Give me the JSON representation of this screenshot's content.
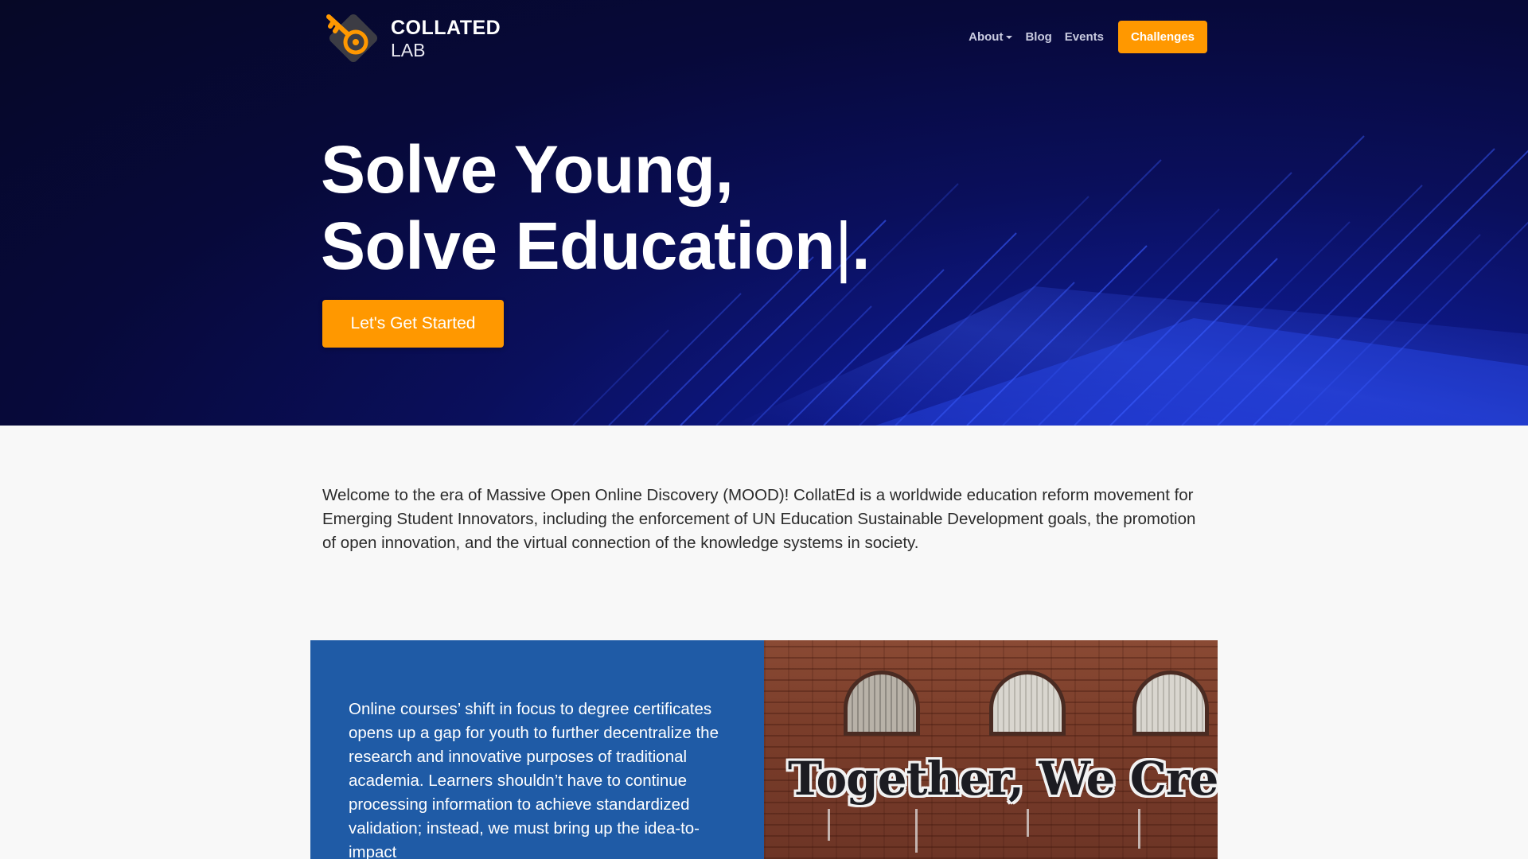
{
  "brand": {
    "name_line1": "COLLATED",
    "name_line2": "LAB",
    "accent_color": "#ff9800",
    "hero_bg_color": "#0a0f5c",
    "feature_bg_color": "#1f5ba6"
  },
  "nav": {
    "about": "About",
    "blog": "Blog",
    "events": "Events",
    "challenges": "Challenges"
  },
  "hero": {
    "line1": "Solve Young,",
    "line2": "Solve Education",
    "cursor": "|",
    "period": ".",
    "cta": "Let's Get Started"
  },
  "intro": {
    "text": "Welcome to the era of Massive Open Online Discovery (MOOD)! CollatEd is a worldwide education reform movement for Emerging Student Innovators, including the enforcement of UN Education Sustainable Development goals, the promotion of open innovation, and the virtual connection of the knowledge systems in society."
  },
  "feature": {
    "text": "Online courses’ shift in focus to degree certificates opens up a gap for youth to further decentralize the research and innovative purposes of traditional academia. Learners shouldn’t have to continue processing information to achieve standardized validation; instead, we must bring up the idea-to-impact",
    "image_caption": "Together, We Create!"
  },
  "icons": {
    "logo": "key-diamond-logo-icon",
    "about_caret": "caret-down-icon"
  }
}
